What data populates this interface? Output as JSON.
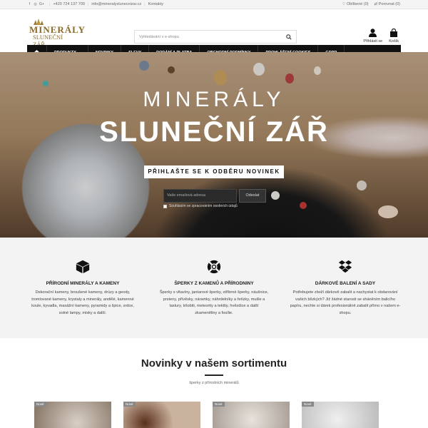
{
  "topbar": {
    "phone": "+420 724 137 709",
    "email": "info@mineralyslunecnizar.cz",
    "contacts": "Kontakty",
    "wishlist": "Oblíbené (0)",
    "compare": "Porovnat (0)"
  },
  "logo": {
    "line1": "MINERÁLY",
    "line2": "SLUNEČNÍ ZÁŘ"
  },
  "search": {
    "placeholder": "Vyhledávání v e-shopu"
  },
  "header": {
    "login": "Přihlásit se",
    "cart": "Košík"
  },
  "nav": {
    "items": [
      "PRODUKTY",
      "NOVINKY",
      "SLEVY",
      "DODÁNÍ A PLATBA",
      "OBCHODNÍ PODMÍNKY",
      "PROHLÁŠENÍ COOKIES",
      "GDPR"
    ]
  },
  "hero": {
    "title1": "MINERÁLY",
    "title2": "SLUNEČNÍ ZÁŘ",
    "subtitle": "PŘIHLAŠTE SE K ODBĚRU NOVINEK",
    "email_placeholder": "Vaše emailová adresa",
    "button": "Odeslat",
    "consent": "Souhlasím se zpracováním osobních údajů"
  },
  "features": [
    {
      "icon": "box-icon",
      "title": "PŘÍRODNÍ MINERÁLY A KAMENY",
      "text": "Dekorační kameny, broušené kameny, drúzy a geody, tromlované kameny, krystaly a minerály, andělé, kamenné koule, kyvadla, masážní kameny, pyramidy a špice, srdce, solné lampy, misky a další."
    },
    {
      "icon": "lifebuoy-icon",
      "title": "ŠPERKY Z KAMENŮ A PŘÍRODNINY",
      "text": "Šperky s vltavíny, jantarové šperky, stříbrné šperky, náušnice, prsteny, přívěsky, náramky, náhrdelníky a řetízky, mušle a lastury, trilobiti, meteority a tektity, hvězdice a další zkameněliny a fosílie."
    },
    {
      "icon": "dropbox-icon",
      "title": "DÁRKOVÉ BALENÍ A SADY",
      "text": "Potřebujete zboží dárkově zabalit a nachystat k obdarování vašich blízkých? Již žádné starosti se sháněním balicího papíru, nechte si dárek profesionálně zabalit přímo v našem e-shopu."
    }
  ],
  "novinky": {
    "title": "Novinky v našem sortimentu",
    "subtitle": "šperky z přírodních minerálů",
    "badge": "Nové"
  }
}
